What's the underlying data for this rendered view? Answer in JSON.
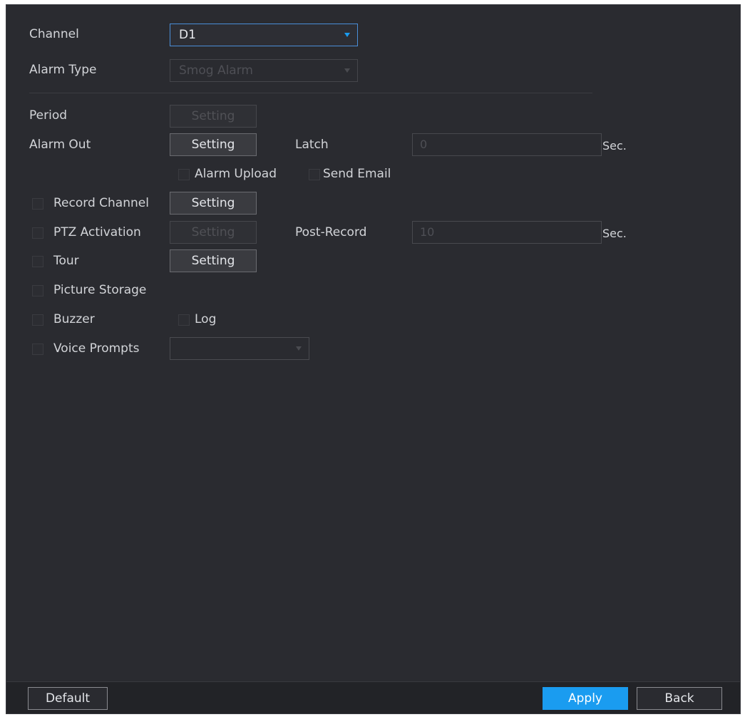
{
  "form": {
    "channel": {
      "label": "Channel",
      "value": "D1"
    },
    "alarm_type": {
      "label": "Alarm Type",
      "value": "Smog Alarm"
    },
    "period": {
      "label": "Period",
      "button": "Setting"
    },
    "alarm_out": {
      "label": "Alarm Out",
      "button": "Setting",
      "latch_label": "Latch",
      "latch_value": "0",
      "latch_unit": "Sec."
    },
    "alarm_upload": {
      "label": "Alarm Upload"
    },
    "send_email": {
      "label": "Send Email"
    },
    "record_channel": {
      "label": "Record Channel",
      "button": "Setting"
    },
    "ptz_activation": {
      "label": "PTZ Activation",
      "button": "Setting",
      "post_record_label": "Post-Record",
      "post_record_value": "10",
      "post_record_unit": "Sec."
    },
    "tour": {
      "label": "Tour",
      "button": "Setting"
    },
    "picture_storage": {
      "label": "Picture Storage"
    },
    "buzzer": {
      "label": "Buzzer"
    },
    "log": {
      "label": "Log"
    },
    "voice_prompts": {
      "label": "Voice Prompts",
      "value": ""
    }
  },
  "footer": {
    "default_label": "Default",
    "apply_label": "Apply",
    "back_label": "Back"
  },
  "colors": {
    "panel": "#2a2b30",
    "accent": "#1a9cf0",
    "text": "#d2d4d8"
  }
}
